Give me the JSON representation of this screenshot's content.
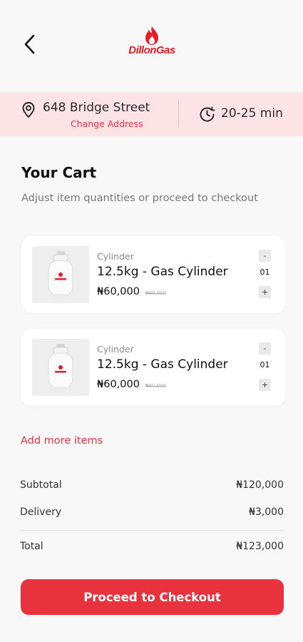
{
  "header": {
    "back_icon": "chevron-left-icon",
    "logo_text": "DillonGas",
    "brand_color": "#e31e24"
  },
  "delivery": {
    "address": "648 Bridge Street",
    "change_address_label": "Change Address",
    "eta": "20-25 min",
    "bar_color": "#fce4e6"
  },
  "cart": {
    "title": "Your Cart",
    "subtitle": "Adjust item quantities or proceed to checkout",
    "items": [
      {
        "category": "Cylinder",
        "name": "12.5kg - Gas Cylinder",
        "price": "₦60,000",
        "old_price": "₦80,000",
        "quantity": "01",
        "decrement_label": "-",
        "increment_label": "+"
      },
      {
        "category": "Cylinder",
        "name": "12.5kg - Gas Cylinder",
        "price": "₦60,000",
        "old_price": "₦80,000",
        "quantity": "01",
        "decrement_label": "-",
        "increment_label": "+"
      }
    ],
    "add_more_label": "Add more items"
  },
  "summary": {
    "subtotal_label": "Subtotal",
    "subtotal_value": "₦120,000",
    "delivery_label": "Delivery",
    "delivery_value": "₦3,000",
    "total_label": "Total",
    "total_value": "₦123,000"
  },
  "checkout_label": "Proceed to Checkout",
  "accent_color": "#e8333f"
}
